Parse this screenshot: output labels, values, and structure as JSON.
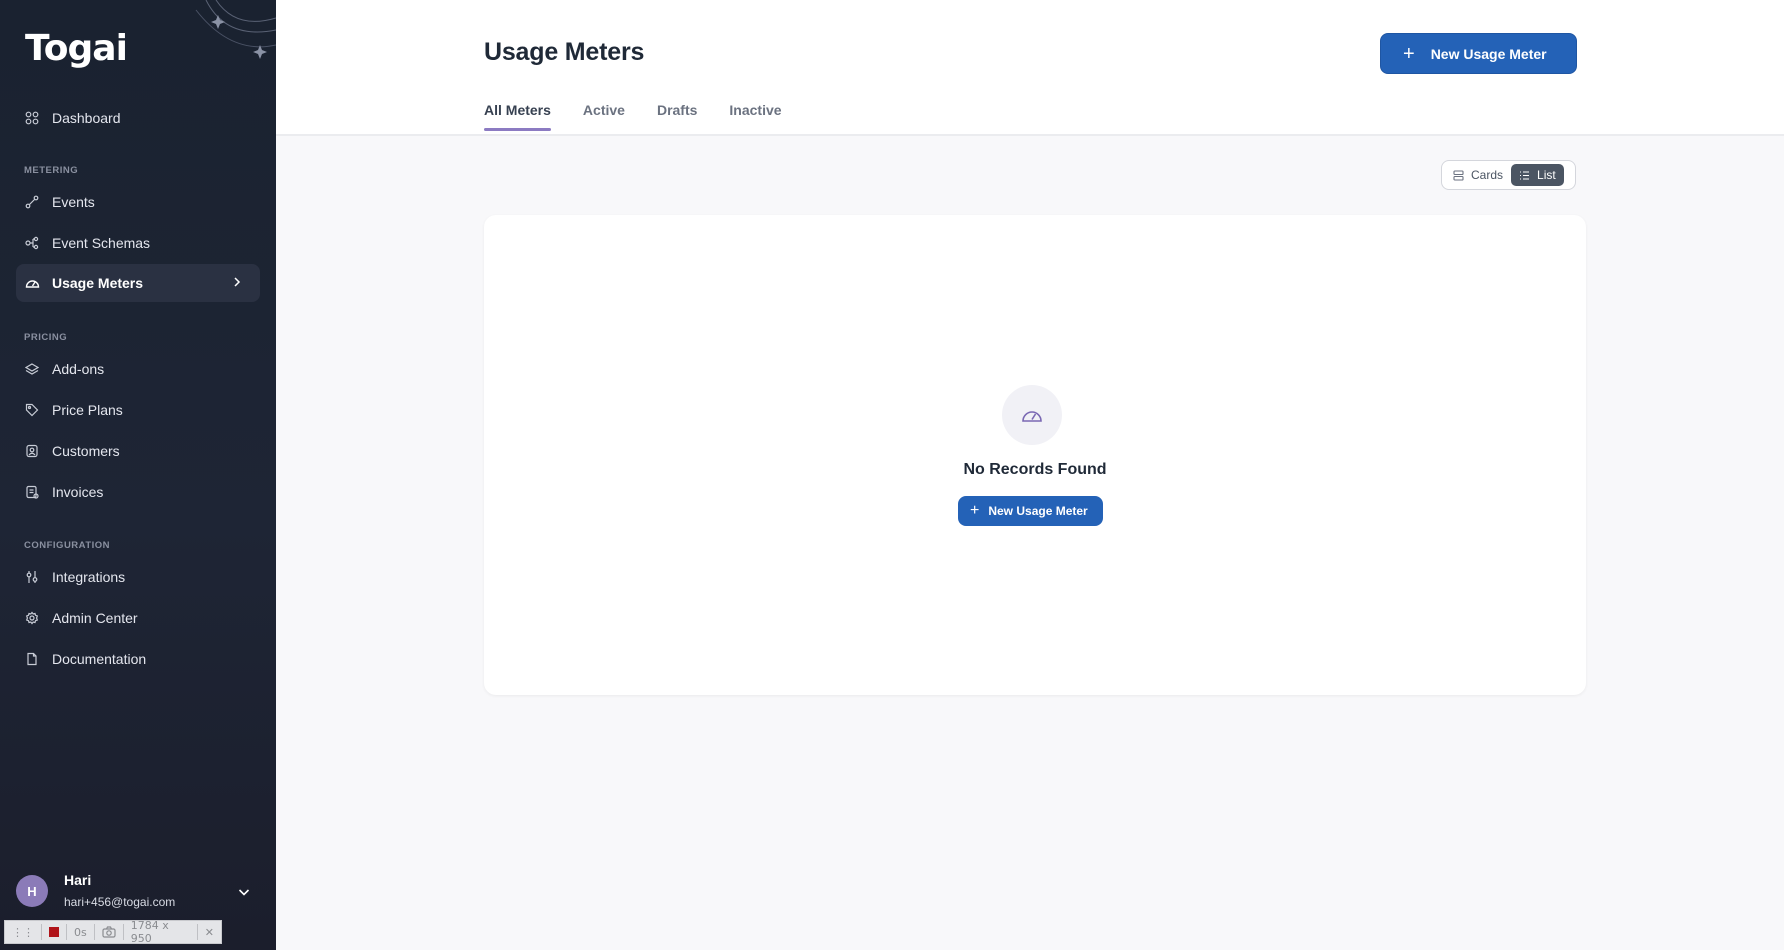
{
  "brand": {
    "logo_text": "Togai"
  },
  "sidebar": {
    "items": [
      {
        "label": "Dashboard",
        "icon": "grid-icon"
      },
      {
        "label": "Events",
        "icon": "route-icon"
      },
      {
        "label": "Event Schemas",
        "icon": "schema-icon"
      },
      {
        "label": "Usage Meters",
        "icon": "gauge-icon",
        "active": true
      },
      {
        "label": "Add-ons",
        "icon": "layers-icon"
      },
      {
        "label": "Price Plans",
        "icon": "tag-icon"
      },
      {
        "label": "Customers",
        "icon": "contact-icon"
      },
      {
        "label": "Invoices",
        "icon": "invoice-icon"
      },
      {
        "label": "Integrations",
        "icon": "sliders-icon"
      },
      {
        "label": "Admin Center",
        "icon": "gear-icon"
      },
      {
        "label": "Documentation",
        "icon": "document-icon"
      }
    ],
    "sections": {
      "metering": "METERING",
      "pricing": "PRICING",
      "configuration": "CONFIGURATION"
    }
  },
  "user": {
    "initial": "H",
    "name": "Hari",
    "email": "hari+456@togai.com"
  },
  "recorder": {
    "time": "0s",
    "size": "1784 x 950"
  },
  "header": {
    "title": "Usage Meters",
    "new_button": "New Usage Meter"
  },
  "tabs": [
    {
      "label": "All Meters",
      "active": true
    },
    {
      "label": "Active"
    },
    {
      "label": "Drafts"
    },
    {
      "label": "Inactive"
    }
  ],
  "view_toggle": {
    "cards": "Cards",
    "list": "List",
    "selected": "List"
  },
  "empty_state": {
    "title": "No Records Found",
    "button": "New Usage Meter"
  },
  "colors": {
    "primary": "#2462b7",
    "tab_indicator": "#8c7bc2",
    "sidebar_bg": "#1e2535"
  }
}
